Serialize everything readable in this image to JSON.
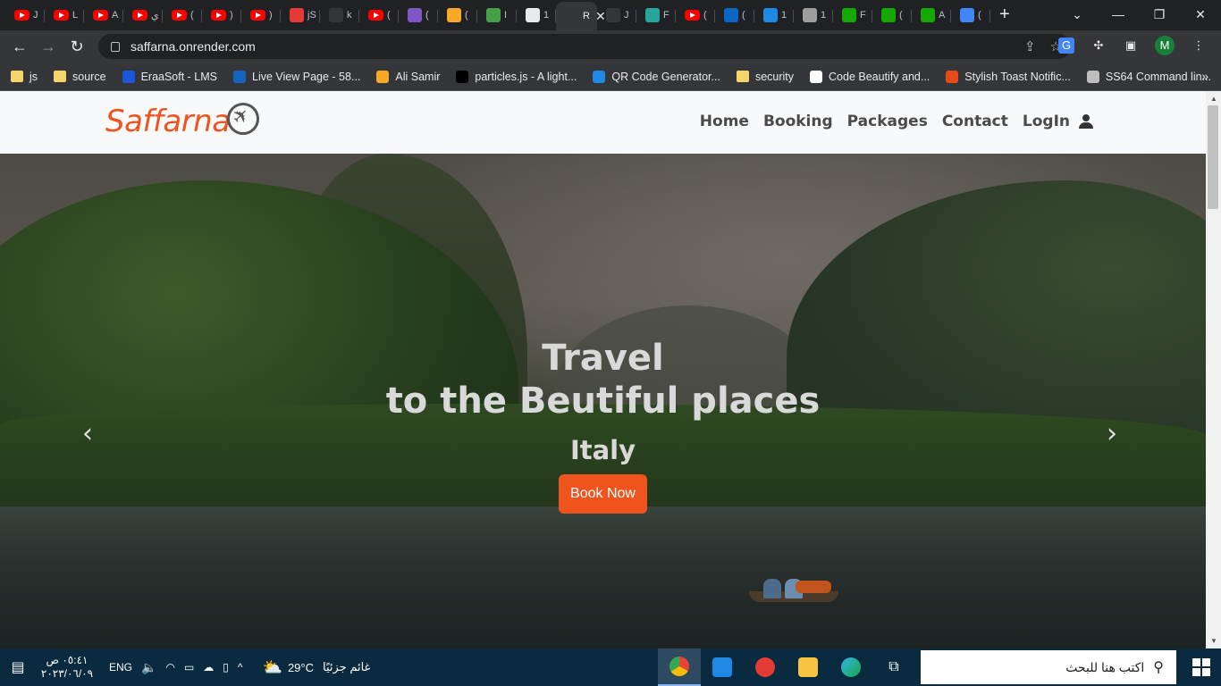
{
  "browser": {
    "tabs": [
      {
        "icon": "youtube-icon",
        "title": "J",
        "type": "yt"
      },
      {
        "icon": "youtube-icon",
        "title": "L",
        "type": "yt"
      },
      {
        "icon": "youtube-icon",
        "title": "A",
        "type": "yt"
      },
      {
        "icon": "youtube-icon",
        "title": "ي",
        "type": "yt"
      },
      {
        "icon": "youtube-icon",
        "title": "(",
        "type": "yt"
      },
      {
        "icon": "youtube-icon",
        "title": ")",
        "type": "yt"
      },
      {
        "icon": "youtube-icon",
        "title": ")",
        "type": "yt"
      },
      {
        "icon": "page-icon",
        "title": "jS",
        "color": "#e53935"
      },
      {
        "icon": "page-icon",
        "title": "k",
        "color": "#35363a"
      },
      {
        "icon": "youtube-icon",
        "title": "(",
        "type": "yt"
      },
      {
        "icon": "discord-icon",
        "title": "(",
        "color": "#7e57c2"
      },
      {
        "icon": "page-icon",
        "title": "(",
        "color": "#f9a825"
      },
      {
        "icon": "page-icon",
        "title": "I",
        "color": "#43a047"
      },
      {
        "icon": "info-icon",
        "title": "1",
        "color": "#e8eaed"
      },
      {
        "icon": "page-icon",
        "title": "R",
        "color": "#35363a",
        "active": true
      },
      {
        "icon": "page-icon",
        "title": "J",
        "color": "#35363a"
      },
      {
        "icon": "page-icon",
        "title": "F",
        "color": "#26a69a"
      },
      {
        "icon": "youtube-icon",
        "title": "(",
        "type": "yt"
      },
      {
        "icon": "linkedin-icon",
        "title": "(",
        "color": "#0a66c2"
      },
      {
        "icon": "page-icon",
        "title": "1",
        "color": "#1e88e5"
      },
      {
        "icon": "page-icon",
        "title": "1",
        "color": "#9e9e9e"
      },
      {
        "icon": "upwork-icon",
        "title": "F",
        "color": "#14a800"
      },
      {
        "icon": "upwork-icon",
        "title": "(",
        "color": "#14a800"
      },
      {
        "icon": "upwork-icon",
        "title": "A",
        "color": "#14a800"
      },
      {
        "icon": "translate-icon",
        "title": "(",
        "color": "#4285f4"
      }
    ],
    "new_tab": "+",
    "url": "saffarna.onrender.com",
    "profile_initial": "M",
    "bookmarks": [
      {
        "label": "js",
        "icon": "folder-icon"
      },
      {
        "label": "source",
        "icon": "folder-icon"
      },
      {
        "label": "EraaSoft - LMS",
        "icon": "eraasoft-icon"
      },
      {
        "label": "Live View Page - 58...",
        "icon": "tm-icon"
      },
      {
        "label": "Ali Samir",
        "icon": "ali-icon"
      },
      {
        "label": "particles.js - A light...",
        "icon": "particles-icon"
      },
      {
        "label": "QR Code Generator...",
        "icon": "qr-icon"
      },
      {
        "label": "security",
        "icon": "folder-icon"
      },
      {
        "label": "Code Beautify and...",
        "icon": "cb-icon"
      },
      {
        "label": "Stylish Toast Notific...",
        "icon": "toast-icon"
      },
      {
        "label": "SS64 Command lin...",
        "icon": "ss64-icon"
      }
    ],
    "bookmarks_more": "»"
  },
  "site": {
    "logo": "Saffarna",
    "nav": [
      "Home",
      "Booking",
      "Packages",
      "Contact",
      "LogIn"
    ],
    "hero": {
      "line1": "Travel",
      "line2": "to the Beutiful places",
      "destination": "Italy",
      "cta": "Book Now",
      "prev": "‹",
      "next": "›"
    }
  },
  "taskbar": {
    "time": "٠٥:٤١ ص",
    "date": "٢٠٢٣/٠٦/٠٩",
    "lang": "ENG",
    "weather_temp": "29°C",
    "weather_desc": "غائم جزئيًا",
    "search_placeholder": "اكتب هنا للبحث"
  }
}
